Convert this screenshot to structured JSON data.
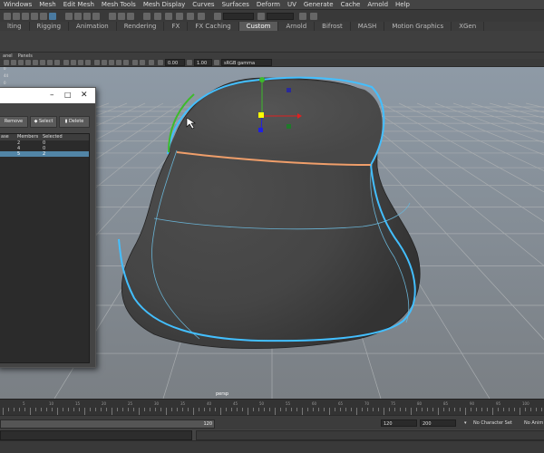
{
  "menubar": {
    "items": [
      "Windows",
      "Mesh",
      "Edit Mesh",
      "Mesh Tools",
      "Mesh Display",
      "Curves",
      "Surfaces",
      "Deform",
      "UV",
      "Generate",
      "Cache",
      "Arnold",
      "Help"
    ]
  },
  "shelf_tabs": {
    "items": [
      "lting",
      "Rigging",
      "Animation",
      "Rendering",
      "FX",
      "FX Caching",
      "Custom",
      "Arnold",
      "Bifrost",
      "MASH",
      "Motion Graphics",
      "XGen"
    ],
    "active": "Custom"
  },
  "panel_menu": {
    "items": [
      "anel",
      "Panels"
    ]
  },
  "view_toolbar": {
    "exposure": "0.00",
    "gamma": "1.00",
    "colorspace": "sRGB gamma"
  },
  "side_numbers": [
    "0",
    "44",
    "0"
  ],
  "set_window": {
    "buttons": {
      "remove": "Remove",
      "select": "Select",
      "delete": "Delete"
    },
    "columns": [
      "ase",
      "Members",
      "Selected"
    ],
    "rows": [
      {
        "name": "",
        "members": "2",
        "selected": "0",
        "selected_row": false
      },
      {
        "name": "",
        "members": "4",
        "selected": "0",
        "selected_row": false
      },
      {
        "name": "",
        "members": "5",
        "selected": "2",
        "selected_row": true
      }
    ]
  },
  "viewport": {
    "camera_label": "persp"
  },
  "timeline": {
    "ticks": [
      "5",
      "10",
      "15",
      "20",
      "25",
      "30",
      "35",
      "40",
      "45",
      "50",
      "55",
      "60",
      "65",
      "70",
      "75",
      "80",
      "85",
      "90",
      "95",
      "100"
    ]
  },
  "range": {
    "current": "120",
    "end": "120",
    "max": "200",
    "character_set": "No Character Set",
    "anim_layer": "No Anim"
  },
  "colors": {
    "highlight_edge": "#43bfff",
    "selected_edge": "#ef9e6a",
    "green_edge": "#3dbb2b",
    "mesh": "#4c4c4c",
    "grid": "#9a9a9a"
  }
}
